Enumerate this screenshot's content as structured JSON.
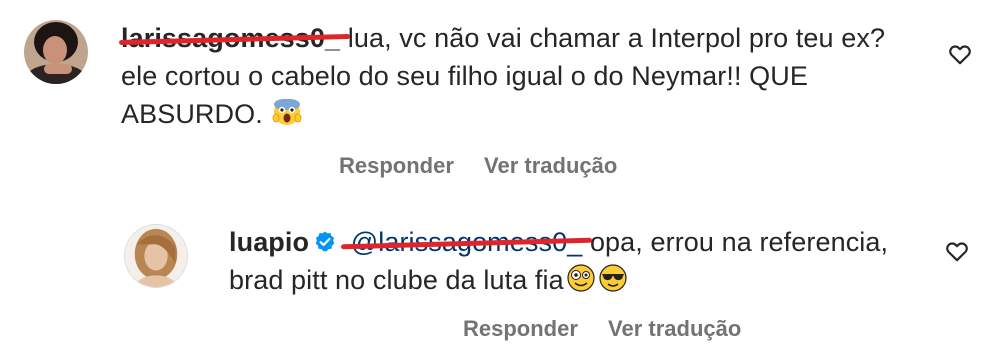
{
  "comments": [
    {
      "username": "larissagomess0_",
      "text_line1": "lua, vc não vai chamar a Interpol pro teu ex?",
      "text_line2": "ele cortou o cabelo do seu filho igual o do Neymar!! QUE",
      "text_line3": "ABSURDO.",
      "emoji": "scream-emoji",
      "actions": {
        "reply": "Responder",
        "translate": "Ver tradução"
      }
    },
    {
      "username": "luapio",
      "verified": true,
      "mention": "@larissagomess0_",
      "text_line1": " opa, errou na referencia,",
      "text_line2": "brad pitt no clube da luta fia",
      "emojis": [
        "zany-face-emoji",
        "sunglasses-emoji"
      ],
      "actions": {
        "reply": "Responder",
        "translate": "Ver tradução"
      }
    }
  ],
  "colors": {
    "text": "#262626",
    "secondary": "#737373",
    "mention": "#00376b",
    "verified": "#0095f6",
    "redaction": "#e0242b"
  },
  "icons": [
    "heart-outline-icon",
    "verified-badge-icon"
  ]
}
